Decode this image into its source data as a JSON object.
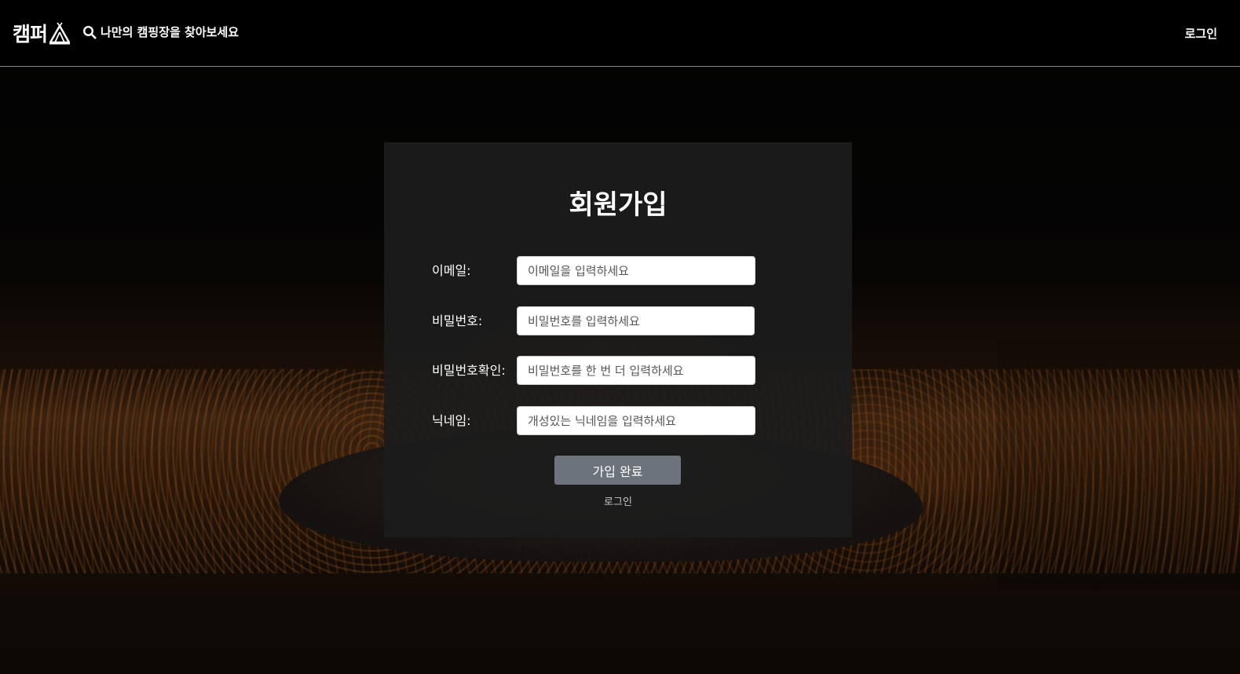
{
  "header": {
    "logo_text": "캠퍼",
    "logo_icon": "tent-icon",
    "search_icon": "search-icon",
    "search_label": "나만의 캠핑장을 찾아보세요",
    "login_label": "로그인"
  },
  "signup": {
    "title": "회원가입",
    "fields": [
      {
        "label": "이메일:",
        "placeholder": "이메일을 입력하세요",
        "value": ""
      },
      {
        "label": "비밀번호:",
        "placeholder": "비밀번호를 입력하세요",
        "value": ""
      },
      {
        "label": "비밀번호확인:",
        "placeholder": "비밀번호를 한 번 더 입력하세요",
        "value": ""
      },
      {
        "label": "닉네임:",
        "placeholder": "개성있는 닉네임을 입력하세요",
        "value": ""
      }
    ],
    "submit_label": "가입 완료",
    "login_link": "로그인"
  },
  "colors": {
    "header_bg": "#000000",
    "panel_bg": "#1c1c1c",
    "button_bg": "#6c737c"
  }
}
